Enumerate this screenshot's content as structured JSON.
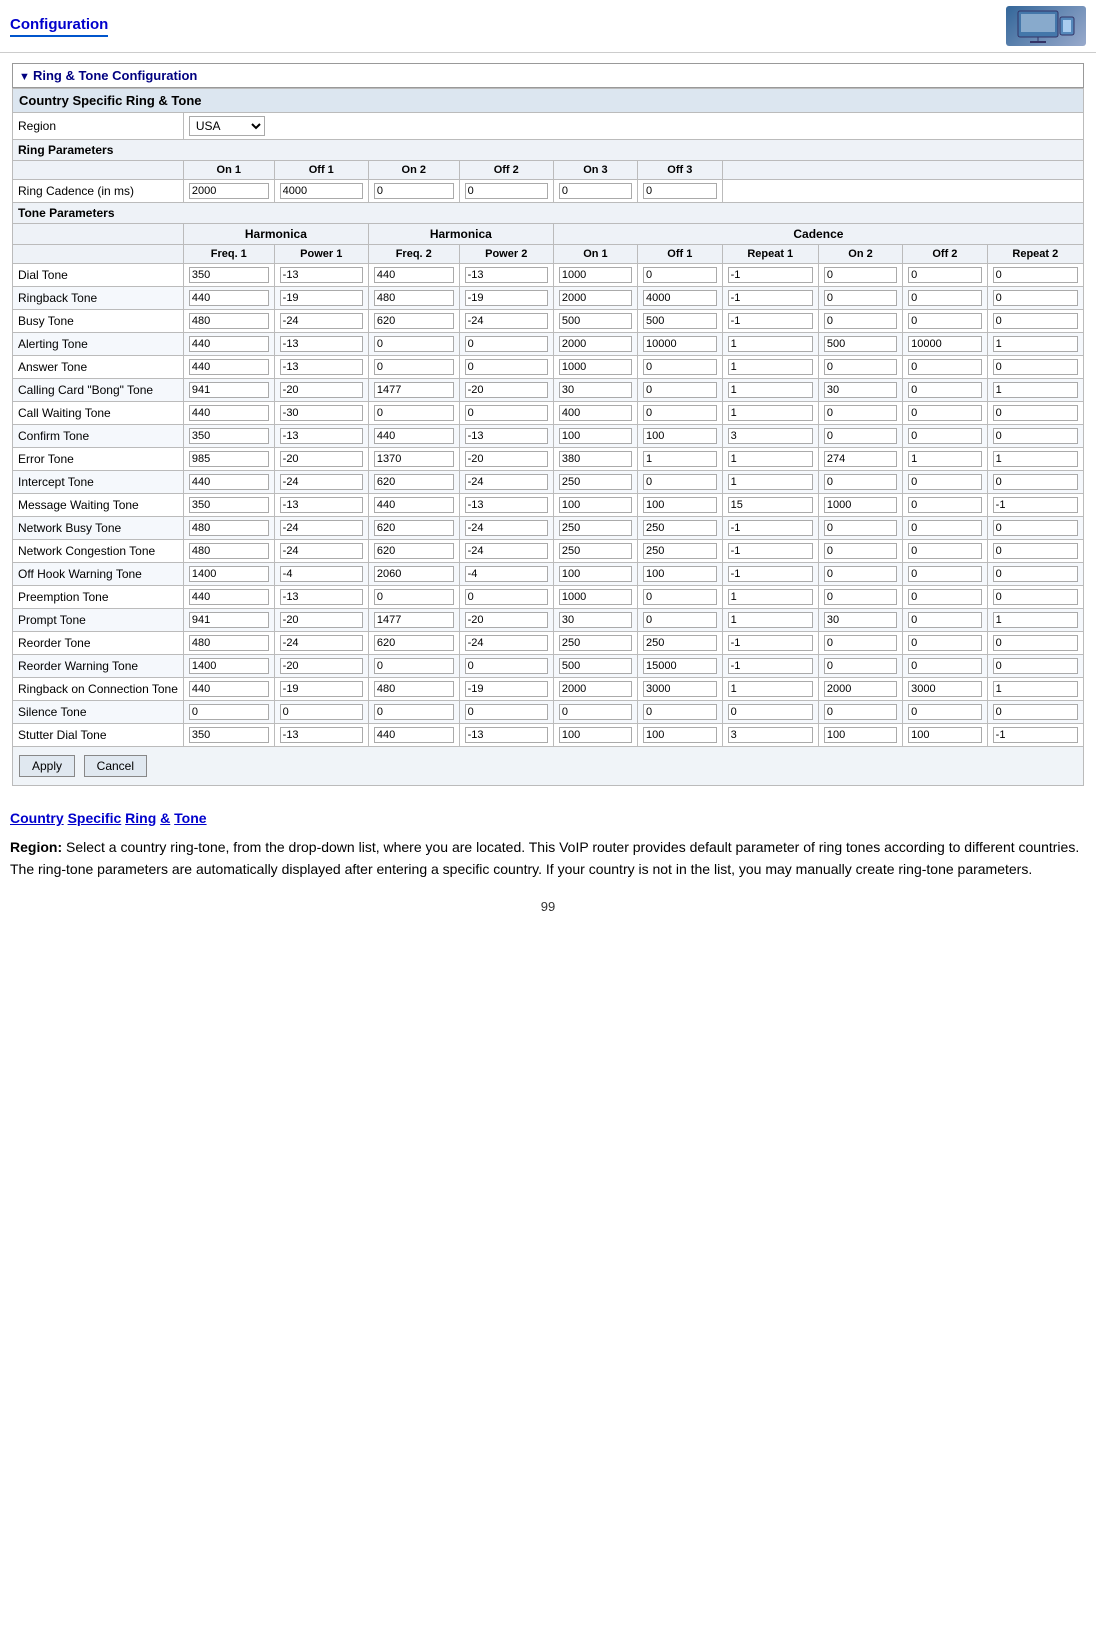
{
  "header": {
    "title": "Configuration"
  },
  "section": {
    "title": "Ring & Tone Configuration",
    "subsection": "Country Specific Ring & Tone"
  },
  "region": {
    "label": "Region",
    "value": "USA"
  },
  "ring_parameters": {
    "label": "Ring Parameters",
    "columns": [
      "On 1",
      "Off 1",
      "On 2",
      "Off 2",
      "On 3",
      "Off 3"
    ],
    "row_label": "Ring Cadence (in ms)",
    "values": [
      "2000",
      "4000",
      "0",
      "0",
      "0",
      "0"
    ]
  },
  "tone_parameters": {
    "label": "Tone Parameters",
    "harmonica_label": "Harmonica",
    "cadence_label": "Cadence",
    "columns": [
      "Freq. 1",
      "Power 1",
      "Freq. 2",
      "Power 2",
      "On 1",
      "Off 1",
      "Repeat 1",
      "On 2",
      "Off 2",
      "Repeat 2"
    ],
    "rows": [
      {
        "name": "Dial Tone",
        "values": [
          "350",
          "-13",
          "440",
          "-13",
          "1000",
          "0",
          "-1",
          "0",
          "0",
          "0"
        ]
      },
      {
        "name": "Ringback Tone",
        "values": [
          "440",
          "-19",
          "480",
          "-19",
          "2000",
          "4000",
          "-1",
          "0",
          "0",
          "0"
        ]
      },
      {
        "name": "Busy Tone",
        "values": [
          "480",
          "-24",
          "620",
          "-24",
          "500",
          "500",
          "-1",
          "0",
          "0",
          "0"
        ]
      },
      {
        "name": "Alerting Tone",
        "values": [
          "440",
          "-13",
          "0",
          "0",
          "2000",
          "10000",
          "1",
          "500",
          "10000",
          "1"
        ]
      },
      {
        "name": "Answer Tone",
        "values": [
          "440",
          "-13",
          "0",
          "0",
          "1000",
          "0",
          "1",
          "0",
          "0",
          "0"
        ]
      },
      {
        "name": "Calling Card \"Bong\" Tone",
        "values": [
          "941",
          "-20",
          "1477",
          "-20",
          "30",
          "0",
          "1",
          "30",
          "0",
          "1"
        ]
      },
      {
        "name": "Call Waiting Tone",
        "values": [
          "440",
          "-30",
          "0",
          "0",
          "400",
          "0",
          "1",
          "0",
          "0",
          "0"
        ]
      },
      {
        "name": "Confirm Tone",
        "values": [
          "350",
          "-13",
          "440",
          "-13",
          "100",
          "100",
          "3",
          "0",
          "0",
          "0"
        ]
      },
      {
        "name": "Error Tone",
        "values": [
          "985",
          "-20",
          "1370",
          "-20",
          "380",
          "1",
          "1",
          "274",
          "1",
          "1"
        ]
      },
      {
        "name": "Intercept Tone",
        "values": [
          "440",
          "-24",
          "620",
          "-24",
          "250",
          "0",
          "1",
          "0",
          "0",
          "0"
        ]
      },
      {
        "name": "Message Waiting Tone",
        "values": [
          "350",
          "-13",
          "440",
          "-13",
          "100",
          "100",
          "15",
          "1000",
          "0",
          "-1"
        ]
      },
      {
        "name": "Network Busy Tone",
        "values": [
          "480",
          "-24",
          "620",
          "-24",
          "250",
          "250",
          "-1",
          "0",
          "0",
          "0"
        ]
      },
      {
        "name": "Network Congestion Tone",
        "values": [
          "480",
          "-24",
          "620",
          "-24",
          "250",
          "250",
          "-1",
          "0",
          "0",
          "0"
        ]
      },
      {
        "name": "Off Hook Warning Tone",
        "values": [
          "1400",
          "-4",
          "2060",
          "-4",
          "100",
          "100",
          "-1",
          "0",
          "0",
          "0"
        ]
      },
      {
        "name": "Preemption Tone",
        "values": [
          "440",
          "-13",
          "0",
          "0",
          "1000",
          "0",
          "1",
          "0",
          "0",
          "0"
        ]
      },
      {
        "name": "Prompt Tone",
        "values": [
          "941",
          "-20",
          "1477",
          "-20",
          "30",
          "0",
          "1",
          "30",
          "0",
          "1"
        ]
      },
      {
        "name": "Reorder Tone",
        "values": [
          "480",
          "-24",
          "620",
          "-24",
          "250",
          "250",
          "-1",
          "0",
          "0",
          "0"
        ]
      },
      {
        "name": "Reorder Warning Tone",
        "values": [
          "1400",
          "-20",
          "0",
          "0",
          "500",
          "15000",
          "-1",
          "0",
          "0",
          "0"
        ]
      },
      {
        "name": "Ringback on Connection Tone",
        "values": [
          "440",
          "-19",
          "480",
          "-19",
          "2000",
          "3000",
          "1",
          "2000",
          "3000",
          "1"
        ]
      },
      {
        "name": "Silence Tone",
        "values": [
          "0",
          "0",
          "0",
          "0",
          "0",
          "0",
          "0",
          "0",
          "0",
          "0"
        ]
      },
      {
        "name": "Stutter Dial Tone",
        "values": [
          "350",
          "-13",
          "440",
          "-13",
          "100",
          "100",
          "3",
          "100",
          "100",
          "-1"
        ]
      }
    ]
  },
  "buttons": {
    "apply": "Apply",
    "cancel": "Cancel"
  },
  "description": {
    "links": [
      "Country",
      "Specific",
      "Ring",
      "&",
      "Tone"
    ],
    "link_text": "Country Specific Ring & Tone",
    "body_label": "Region:",
    "body_text": "Select a country ring-tone, from the drop-down list, where you are located. This VoIP router provides default parameter of ring tones according to different countries.  The ring-tone parameters are automatically displayed after entering a specific country.  If your country is not in the list, you may manually create ring-tone parameters."
  },
  "page_number": "99"
}
